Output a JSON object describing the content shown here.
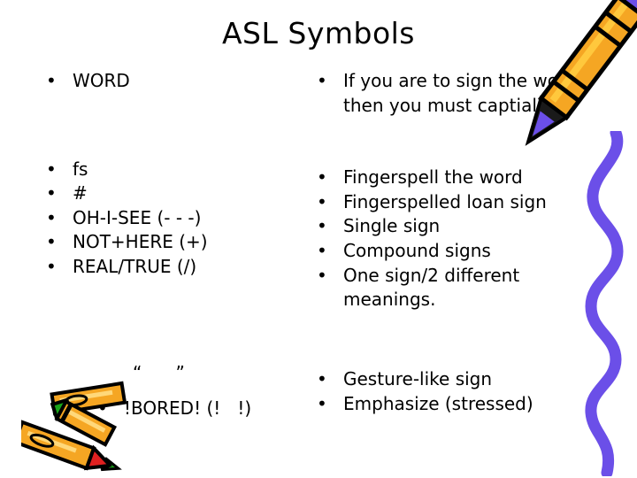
{
  "slide": {
    "title": "ASL Symbols",
    "background_color": "#FFFFFF",
    "text_color": "#000000"
  },
  "left_column": {
    "group_1": [
      {
        "bullet": "•",
        "text": "WORD"
      }
    ],
    "group_2": [
      {
        "bullet": "•",
        "text": "fs"
      },
      {
        "bullet": "•",
        "text": "#"
      },
      {
        "bullet": "•",
        "text": "OH-I-SEE (- - -)"
      },
      {
        "bullet": "•",
        "text": "NOT+HERE (+)"
      },
      {
        "bullet": "•",
        "text": "REAL/TRUE (/)"
      }
    ],
    "group_3": {
      "quote_marks": "“      ”",
      "bullet": "•",
      "text": "!BORED! (!   !)"
    }
  },
  "right_column": {
    "group_1": [
      {
        "bullet": "•",
        "text": "If you are to sign the word then you must captialize"
      }
    ],
    "group_2": [
      {
        "bullet": "•",
        "text": "Fingerspell the word"
      },
      {
        "bullet": "•",
        "text": "Fingerspelled loan sign"
      },
      {
        "bullet": "•",
        "text": "Single sign"
      },
      {
        "bullet": "•",
        "text": "Compound signs"
      },
      {
        "bullet": "•",
        "text": "One sign/2 different meanings."
      }
    ],
    "group_3": [
      {
        "bullet": "•",
        "text": "Gesture-like sign"
      },
      {
        "bullet": "•",
        "text": "Emphasize (stressed)"
      }
    ]
  },
  "decorations": {
    "pencil_top_right": {
      "name": "pencil-crayon-clipart",
      "body_color": "#F5A623",
      "highlight_color": "#FFC83D",
      "tip_color": "#6B4FE8",
      "outline_color": "#000000"
    },
    "crayons_bottom_left": {
      "name": "crayons-clipart",
      "body_color": "#F5A623",
      "highlight_color": "#FFD87A",
      "tip_color_1": "#19A519",
      "tip_color_2": "#E02020",
      "outline_color": "#000000"
    },
    "squiggle_right": {
      "name": "purple-squiggle",
      "color": "#6B4FE8"
    }
  }
}
